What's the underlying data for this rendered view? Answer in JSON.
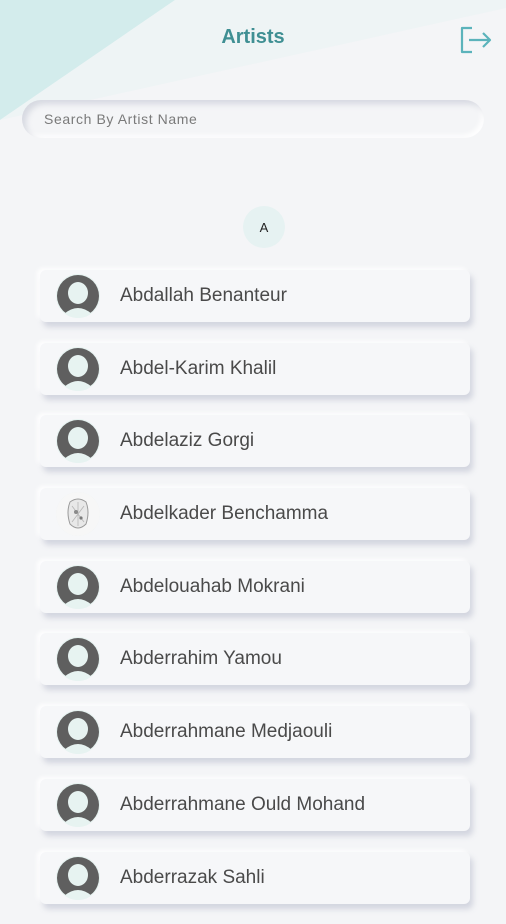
{
  "header": {
    "title": "Artists"
  },
  "search": {
    "placeholder": "Search By Artist Name"
  },
  "section_letter": "A",
  "artists": [
    {
      "name": "Abdallah Benanteur",
      "avatar": "default-avatar"
    },
    {
      "name": "Abdel-Karim Khalil",
      "avatar": "default-avatar"
    },
    {
      "name": "Abdelaziz Gorgi",
      "avatar": "default-avatar"
    },
    {
      "name": "Abdelkader Benchamma",
      "avatar": "artwork-thumbnail"
    },
    {
      "name": "Abdelouahab Mokrani",
      "avatar": "default-avatar"
    },
    {
      "name": "Abderrahim Yamou",
      "avatar": "default-avatar"
    },
    {
      "name": "Abderrahmane Medjaouli",
      "avatar": "default-avatar"
    },
    {
      "name": "Abderrahmane Ould Mohand",
      "avatar": "default-avatar"
    },
    {
      "name": "Abderrazak Sahli",
      "avatar": "default-avatar"
    }
  ],
  "colors": {
    "accent": "#3f8f93",
    "background": "#f4f5f7",
    "triangle": "#d4ecec"
  }
}
